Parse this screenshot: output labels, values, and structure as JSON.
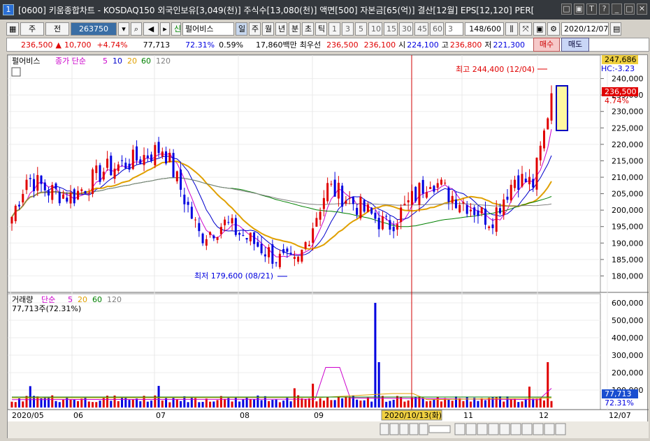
{
  "window": {
    "number": "1",
    "title": "[0600] 키움종합차트 - KOSDAQ150 외국인보유[3,049(천)] 주식수[13,080(천)] 액면[500] 자본금[65(억)] 결산[12월] EPS[12,120] PER[",
    "buttons": [
      "□",
      "▣",
      "T",
      "?",
      "_",
      "□",
      "✕"
    ]
  },
  "toolbar": {
    "period_type": "주",
    "market": "전",
    "code": "263750",
    "credit_tag": "신",
    "stock_name": "펄어비스",
    "period_tabs": [
      "일",
      "주",
      "월",
      "년",
      "분",
      "초",
      "틱"
    ],
    "intervals": [
      "1",
      "3",
      "5",
      "10",
      "15",
      "30",
      "45",
      "60"
    ],
    "interval_value": "3",
    "count": "148/600",
    "date": "2020/12/07"
  },
  "quote": {
    "price": "236,500",
    "arrow": "▲",
    "change": "10,700",
    "change_pct": "+4.74%",
    "volume": "77,713",
    "volume_ratio": "72.31%",
    "turnover": "0.59%",
    "amount": "17,860백만",
    "best_ask_label": "최우선",
    "best_ask": "236,500",
    "best_bid": "236,100",
    "open_label": "시",
    "open": "224,100",
    "high_label": "고",
    "high": "236,800",
    "low_label": "저",
    "low": "221,300",
    "buy_label": "매수",
    "sell_label": "매도"
  },
  "price_panel": {
    "legend_name": "펄어비스",
    "legend_ma": "종가 단순",
    "ma_periods": [
      "5",
      "10",
      "20",
      "60",
      "120"
    ],
    "ma_colors": [
      "#cc00cc",
      "#0000cc",
      "#e0a000",
      "#008000",
      "#808080"
    ],
    "high_label": "최고 244,400 (12/04)",
    "low_label": "최저 179,600 (08/21)",
    "hc_label": "HC:-3.23",
    "axis_top_value": "247,686",
    "current_value": "236,500",
    "current_pct": "4.74%",
    "axis_ticks": [
      "240,000",
      "235,000",
      "230,000",
      "225,000",
      "220,000",
      "215,000",
      "210,000",
      "205,000",
      "200,000",
      "195,000",
      "190,000",
      "185,000",
      "180,000"
    ]
  },
  "volume_panel": {
    "legend_name": "거래량",
    "legend_ma": "단순",
    "ma_periods": [
      "5",
      "20",
      "60",
      "120"
    ],
    "value_label": "77,713주(72.31%)",
    "axis_ticks": [
      "600,000",
      "500,000",
      "400,000",
      "300,000",
      "200,000",
      "100,000"
    ],
    "current_value": "77,713",
    "current_pct": "72.31%"
  },
  "x_axis": {
    "labels": [
      "2020/05",
      "06",
      "07",
      "08",
      "09",
      "10",
      "11",
      "12",
      "12/07"
    ],
    "cursor_label": "2020/10/13(화)"
  },
  "colors": {
    "up": "#e00000",
    "down": "#0000e0",
    "cursor": "#d00000"
  }
}
